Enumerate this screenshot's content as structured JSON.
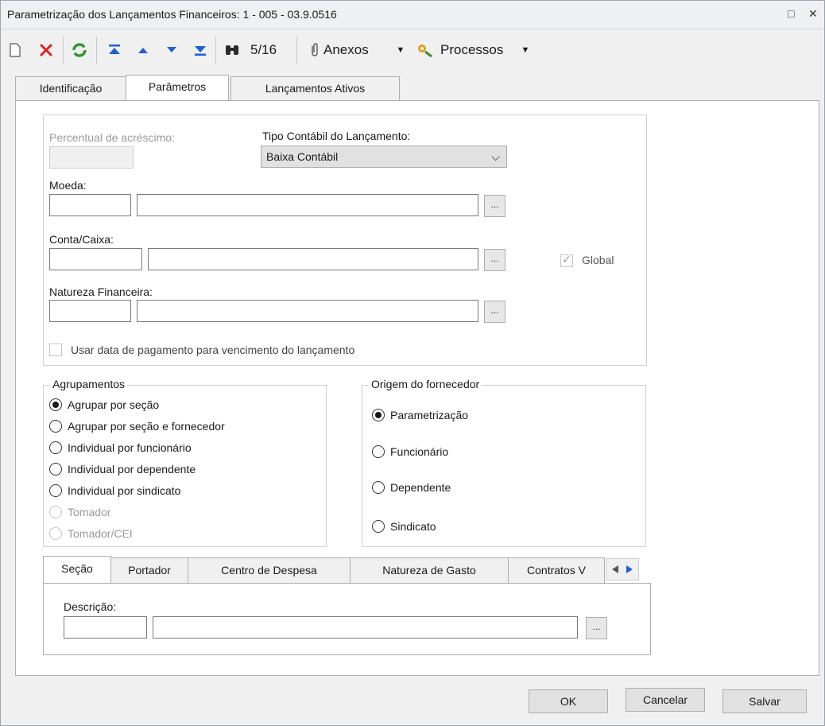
{
  "window": {
    "title": "Parametrização dos Lançamentos Financeiros: 1 - 005 - 03.9.0516",
    "restore_glyph": "□",
    "close_glyph": "✕"
  },
  "toolbar": {
    "record_position": "5/16",
    "attachments_label": "Anexos",
    "processes_label": "Processos"
  },
  "tabs": [
    {
      "label": "Identificação"
    },
    {
      "label": "Parâmetros"
    },
    {
      "label": "Lançamentos Ativos"
    }
  ],
  "form": {
    "percent_label": "Percentual de acréscimo:",
    "tipo_label": "Tipo Contábil do Lançamento:",
    "tipo_value": "Baixa Contábil",
    "moeda_label": "Moeda:",
    "conta_label": "Conta/Caixa:",
    "global_label": "Global",
    "natureza_label": "Natureza Financeira:",
    "usar_data_label": "Usar data de pagamento para vencimento do lançamento",
    "browse_label": "..."
  },
  "agrupamentos": {
    "title": "Agrupamentos",
    "options": [
      {
        "label": "Agrupar por seção"
      },
      {
        "label": "Agrupar por seção e fornecedor"
      },
      {
        "label": "Individual por funcionário"
      },
      {
        "label": "Individual por dependente"
      },
      {
        "label": "Individual por sindicato"
      },
      {
        "label": "Tomador"
      },
      {
        "label": "Tomador/CEI"
      }
    ]
  },
  "origem": {
    "title": "Origem do fornecedor",
    "options": [
      {
        "label": "Parametrização"
      },
      {
        "label": "Funcionário"
      },
      {
        "label": "Dependente"
      },
      {
        "label": "Sindicato"
      }
    ]
  },
  "subtabs": [
    {
      "label": "Seção"
    },
    {
      "label": "Portador"
    },
    {
      "label": "Centro de Despesa"
    },
    {
      "label": "Natureza de Gasto"
    },
    {
      "label": "Contratos V"
    }
  ],
  "subform": {
    "descricao_label": "Descrição:"
  },
  "buttons": {
    "ok": "OK",
    "cancel": "Cancelar",
    "save": "Salvar"
  },
  "colors": {
    "delete_icon": "#e02020",
    "refresh_icon": "#2e9a2e",
    "nav_icon": "#1f5fd6"
  }
}
